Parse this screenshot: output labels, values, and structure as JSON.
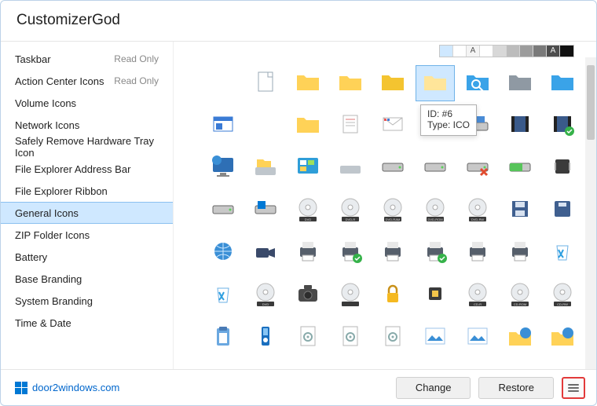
{
  "app": {
    "title": "CustomizerGod"
  },
  "sidebar": {
    "items": [
      {
        "label": "Taskbar",
        "status": "Read Only"
      },
      {
        "label": "Action Center Icons",
        "status": "Read Only"
      },
      {
        "label": "Volume Icons",
        "status": ""
      },
      {
        "label": "Network Icons",
        "status": ""
      },
      {
        "label": "Safely Remove Hardware Tray Icon",
        "status": ""
      },
      {
        "label": "File Explorer Address Bar",
        "status": ""
      },
      {
        "label": "File Explorer Ribbon",
        "status": ""
      },
      {
        "label": "General Icons",
        "status": ""
      },
      {
        "label": "ZIP Folder Icons",
        "status": ""
      },
      {
        "label": "Battery",
        "status": ""
      },
      {
        "label": "Base Branding",
        "status": ""
      },
      {
        "label": "System Branding",
        "status": ""
      },
      {
        "label": "Time & Date",
        "status": ""
      }
    ],
    "selected_index": 7
  },
  "views": {
    "swatches": [
      {
        "bg": "#cfe8ff"
      },
      {
        "bg": "#ffffff"
      },
      {
        "bg": "#f4f4f4",
        "txt": "A"
      },
      {
        "bg": "#ffffff"
      },
      {
        "bg": "#d8d8d8"
      },
      {
        "bg": "#bcbcbc"
      },
      {
        "bg": "#9c9c9c"
      },
      {
        "bg": "#7a7a7a"
      },
      {
        "bg": "#4d4d4d",
        "txt": "A",
        "fg": "#eee"
      },
      {
        "bg": "#111111"
      }
    ]
  },
  "grid": {
    "selected_index": 5
  },
  "tooltip": {
    "line1": "ID: #6",
    "line2": "Type: ICO"
  },
  "footer": {
    "link": "door2windows.com",
    "change": "Change",
    "restore": "Restore"
  },
  "chart_data": {
    "type": "table",
    "note": "icon grid; no numeric chart"
  }
}
